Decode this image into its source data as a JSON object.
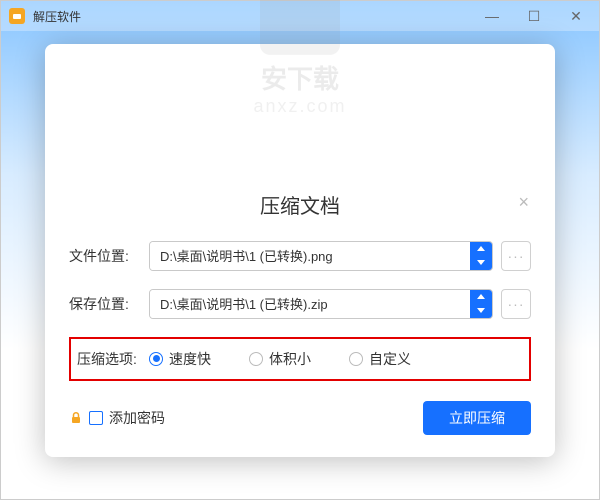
{
  "app": {
    "title": "解压软件",
    "bg_title": "解压软件"
  },
  "modal": {
    "title": "压缩文档",
    "close": "×",
    "file_location": {
      "label": "文件位置:",
      "value": "D:\\桌面\\说明书\\1 (已转换).png",
      "more": "···"
    },
    "save_location": {
      "label": "保存位置:",
      "value": "D:\\桌面\\说明书\\1 (已转换).zip",
      "more": "···"
    },
    "compress_options": {
      "label": "压缩选项:",
      "items": [
        {
          "label": "速度快",
          "selected": true
        },
        {
          "label": "体积小",
          "selected": false
        },
        {
          "label": "自定义",
          "selected": false
        }
      ]
    },
    "add_password": {
      "label": "添加密码",
      "checked": false
    },
    "submit": "立即压缩"
  },
  "watermark": {
    "line1": "安下载",
    "line2": "anxz.com"
  },
  "colors": {
    "accent": "#1670ff",
    "highlight_border": "#e30000",
    "app_accent": "#f5a623"
  }
}
